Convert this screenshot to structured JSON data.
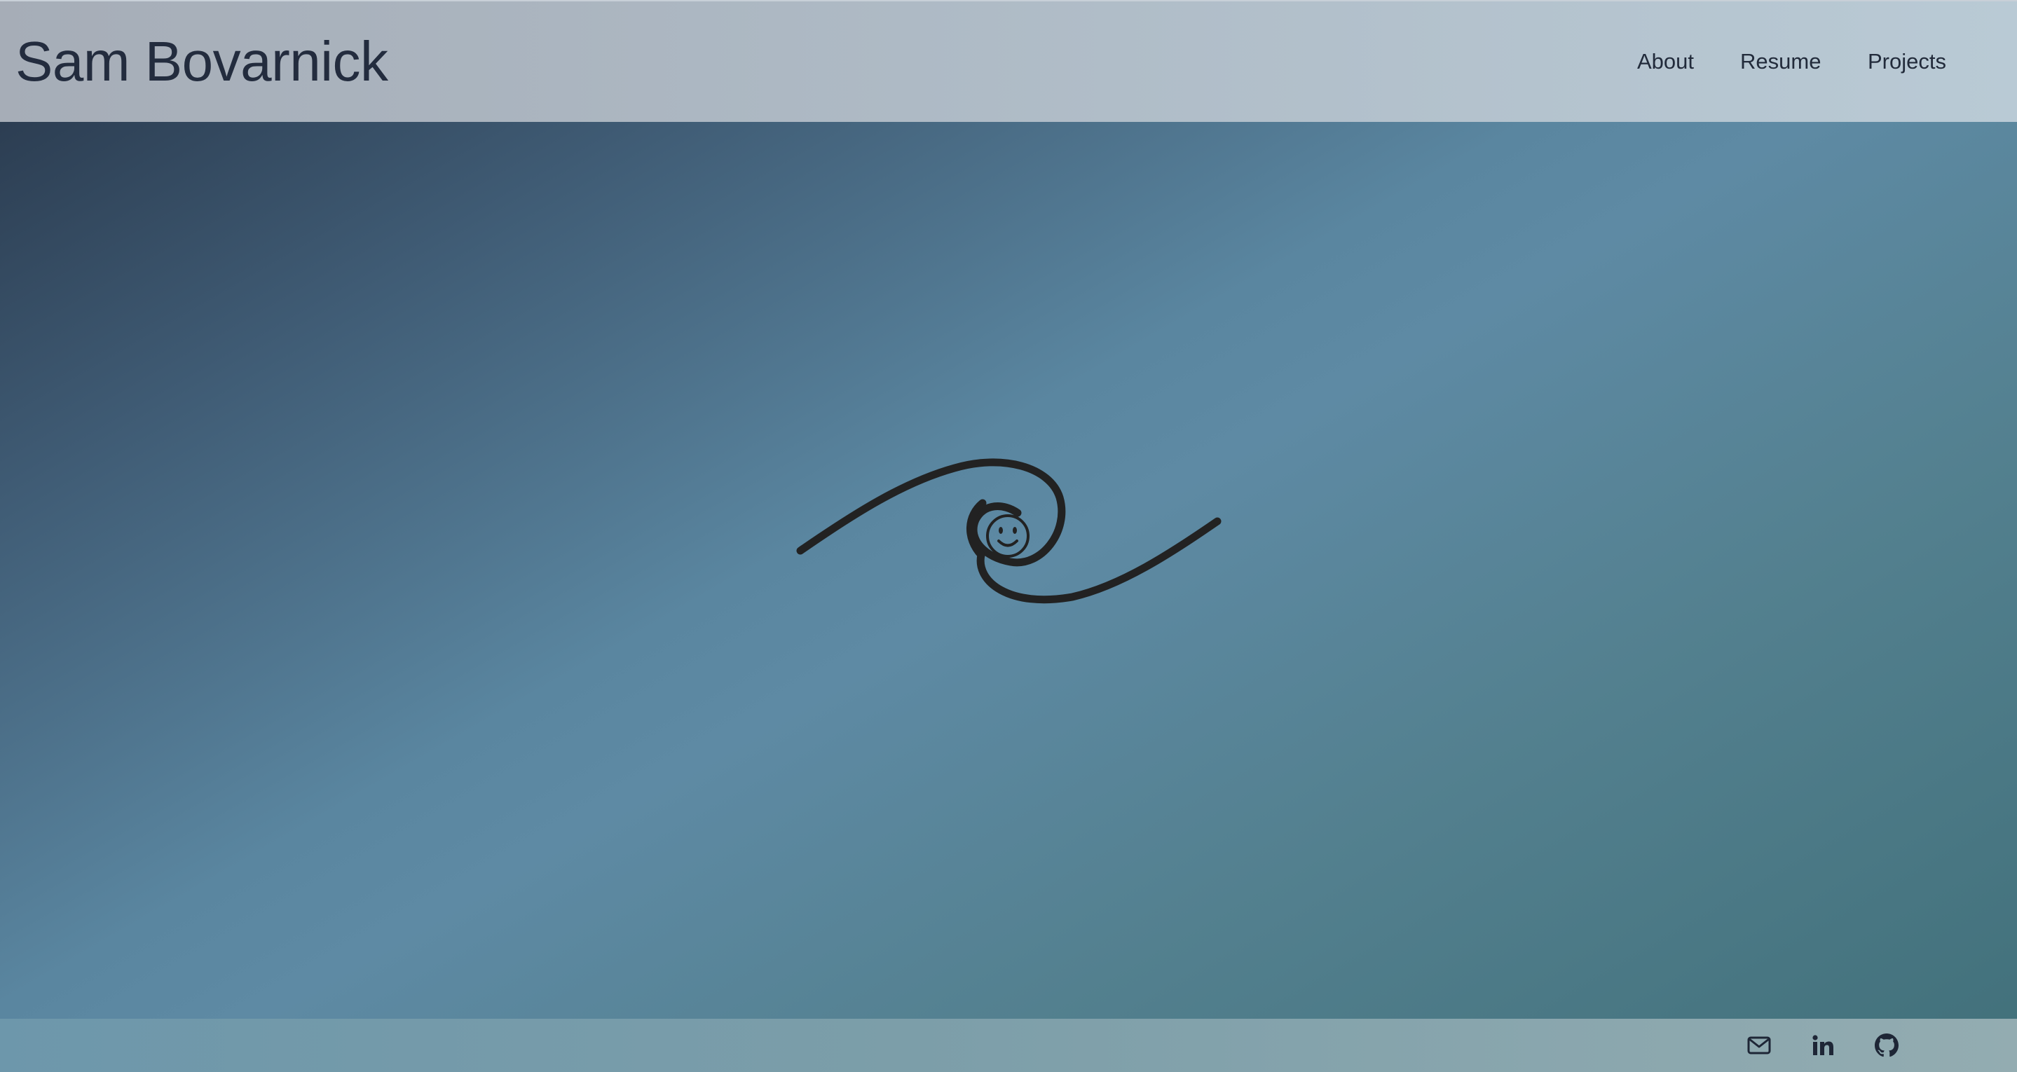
{
  "header": {
    "site_title": "Sam Bovarnick",
    "nav": [
      {
        "label": "About"
      },
      {
        "label": "Resume"
      },
      {
        "label": "Projects"
      }
    ]
  },
  "footer": {
    "links": [
      {
        "icon": "mail-icon"
      },
      {
        "icon": "linkedin-icon"
      },
      {
        "icon": "github-icon"
      }
    ]
  },
  "colors": {
    "text": "#232c3e",
    "logo_stroke": "#222222",
    "header_bg": "#aebac5",
    "footer_bg": "#7c9ea9"
  }
}
